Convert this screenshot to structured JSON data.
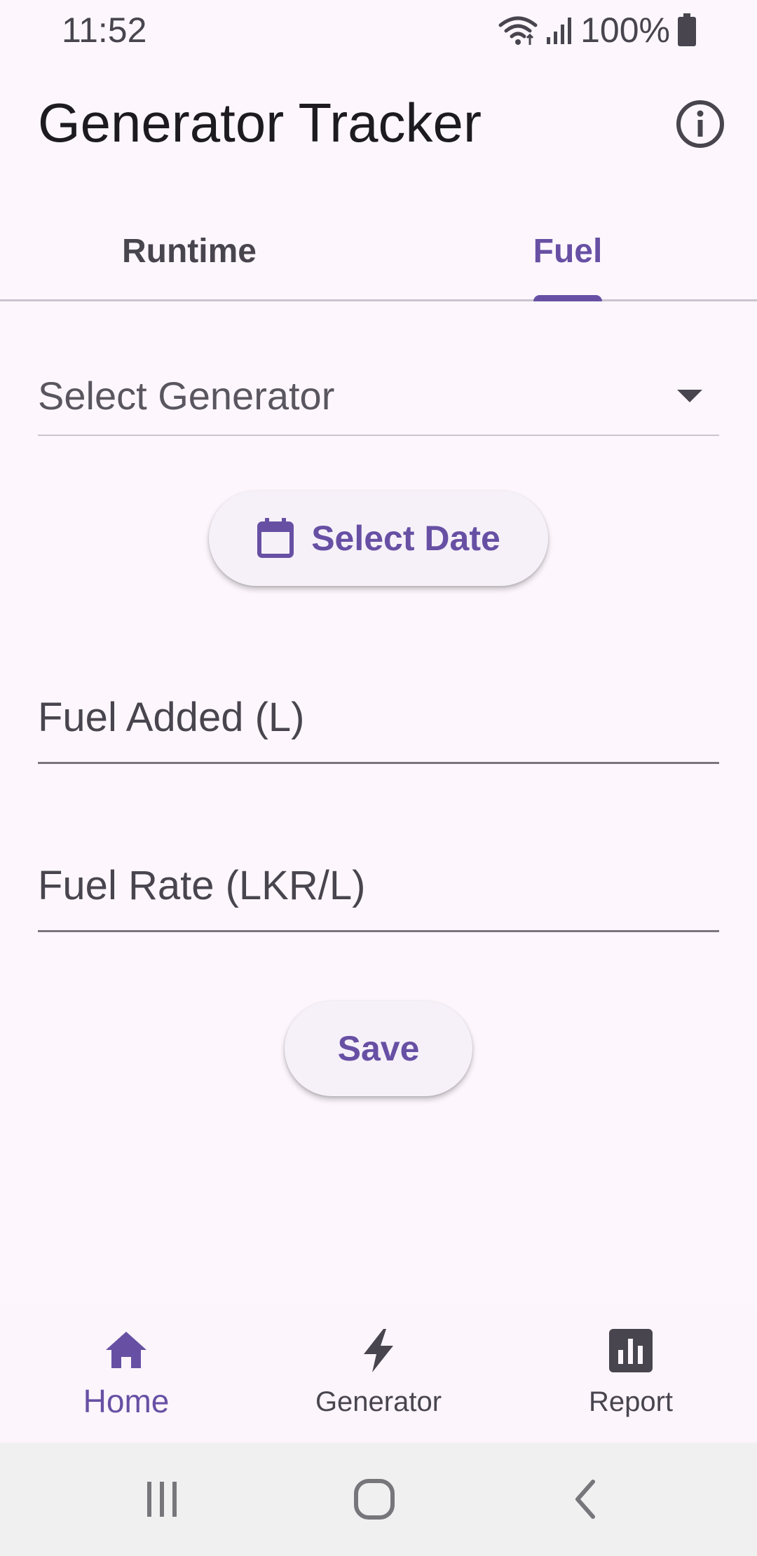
{
  "status_bar": {
    "time": "11:52",
    "battery": "100%",
    "icons": [
      "wifi-icon",
      "signal-icon",
      "battery-icon"
    ]
  },
  "app_bar": {
    "title": "Generator Tracker",
    "action_icon": "info-icon"
  },
  "tabs": [
    {
      "label": "Runtime",
      "active": false
    },
    {
      "label": "Fuel",
      "active": true
    }
  ],
  "form": {
    "generator_dropdown": {
      "label": "Select Generator",
      "icon": "arrow-drop-down-icon"
    },
    "date_button": {
      "label": "Select Date",
      "icon": "calendar-icon"
    },
    "fuel_added": {
      "placeholder": "Fuel Added (L)",
      "value": ""
    },
    "fuel_rate": {
      "placeholder": "Fuel Rate (LKR/L)",
      "value": ""
    },
    "save_label": "Save"
  },
  "bottom_nav": {
    "items": [
      {
        "label": "Home",
        "icon": "home-icon",
        "active": true
      },
      {
        "label": "Generator",
        "icon": "bolt-icon",
        "active": false
      },
      {
        "label": "Report",
        "icon": "bar-chart-icon",
        "active": false
      }
    ]
  },
  "system_nav": [
    "recents-icon",
    "home-circle-icon",
    "back-icon"
  ],
  "colors": {
    "accent": "#6750a4",
    "background": "#fdf7fd",
    "text": "#1d1b20",
    "muted": "#49454f",
    "system_bar": "#f1f0f1"
  }
}
